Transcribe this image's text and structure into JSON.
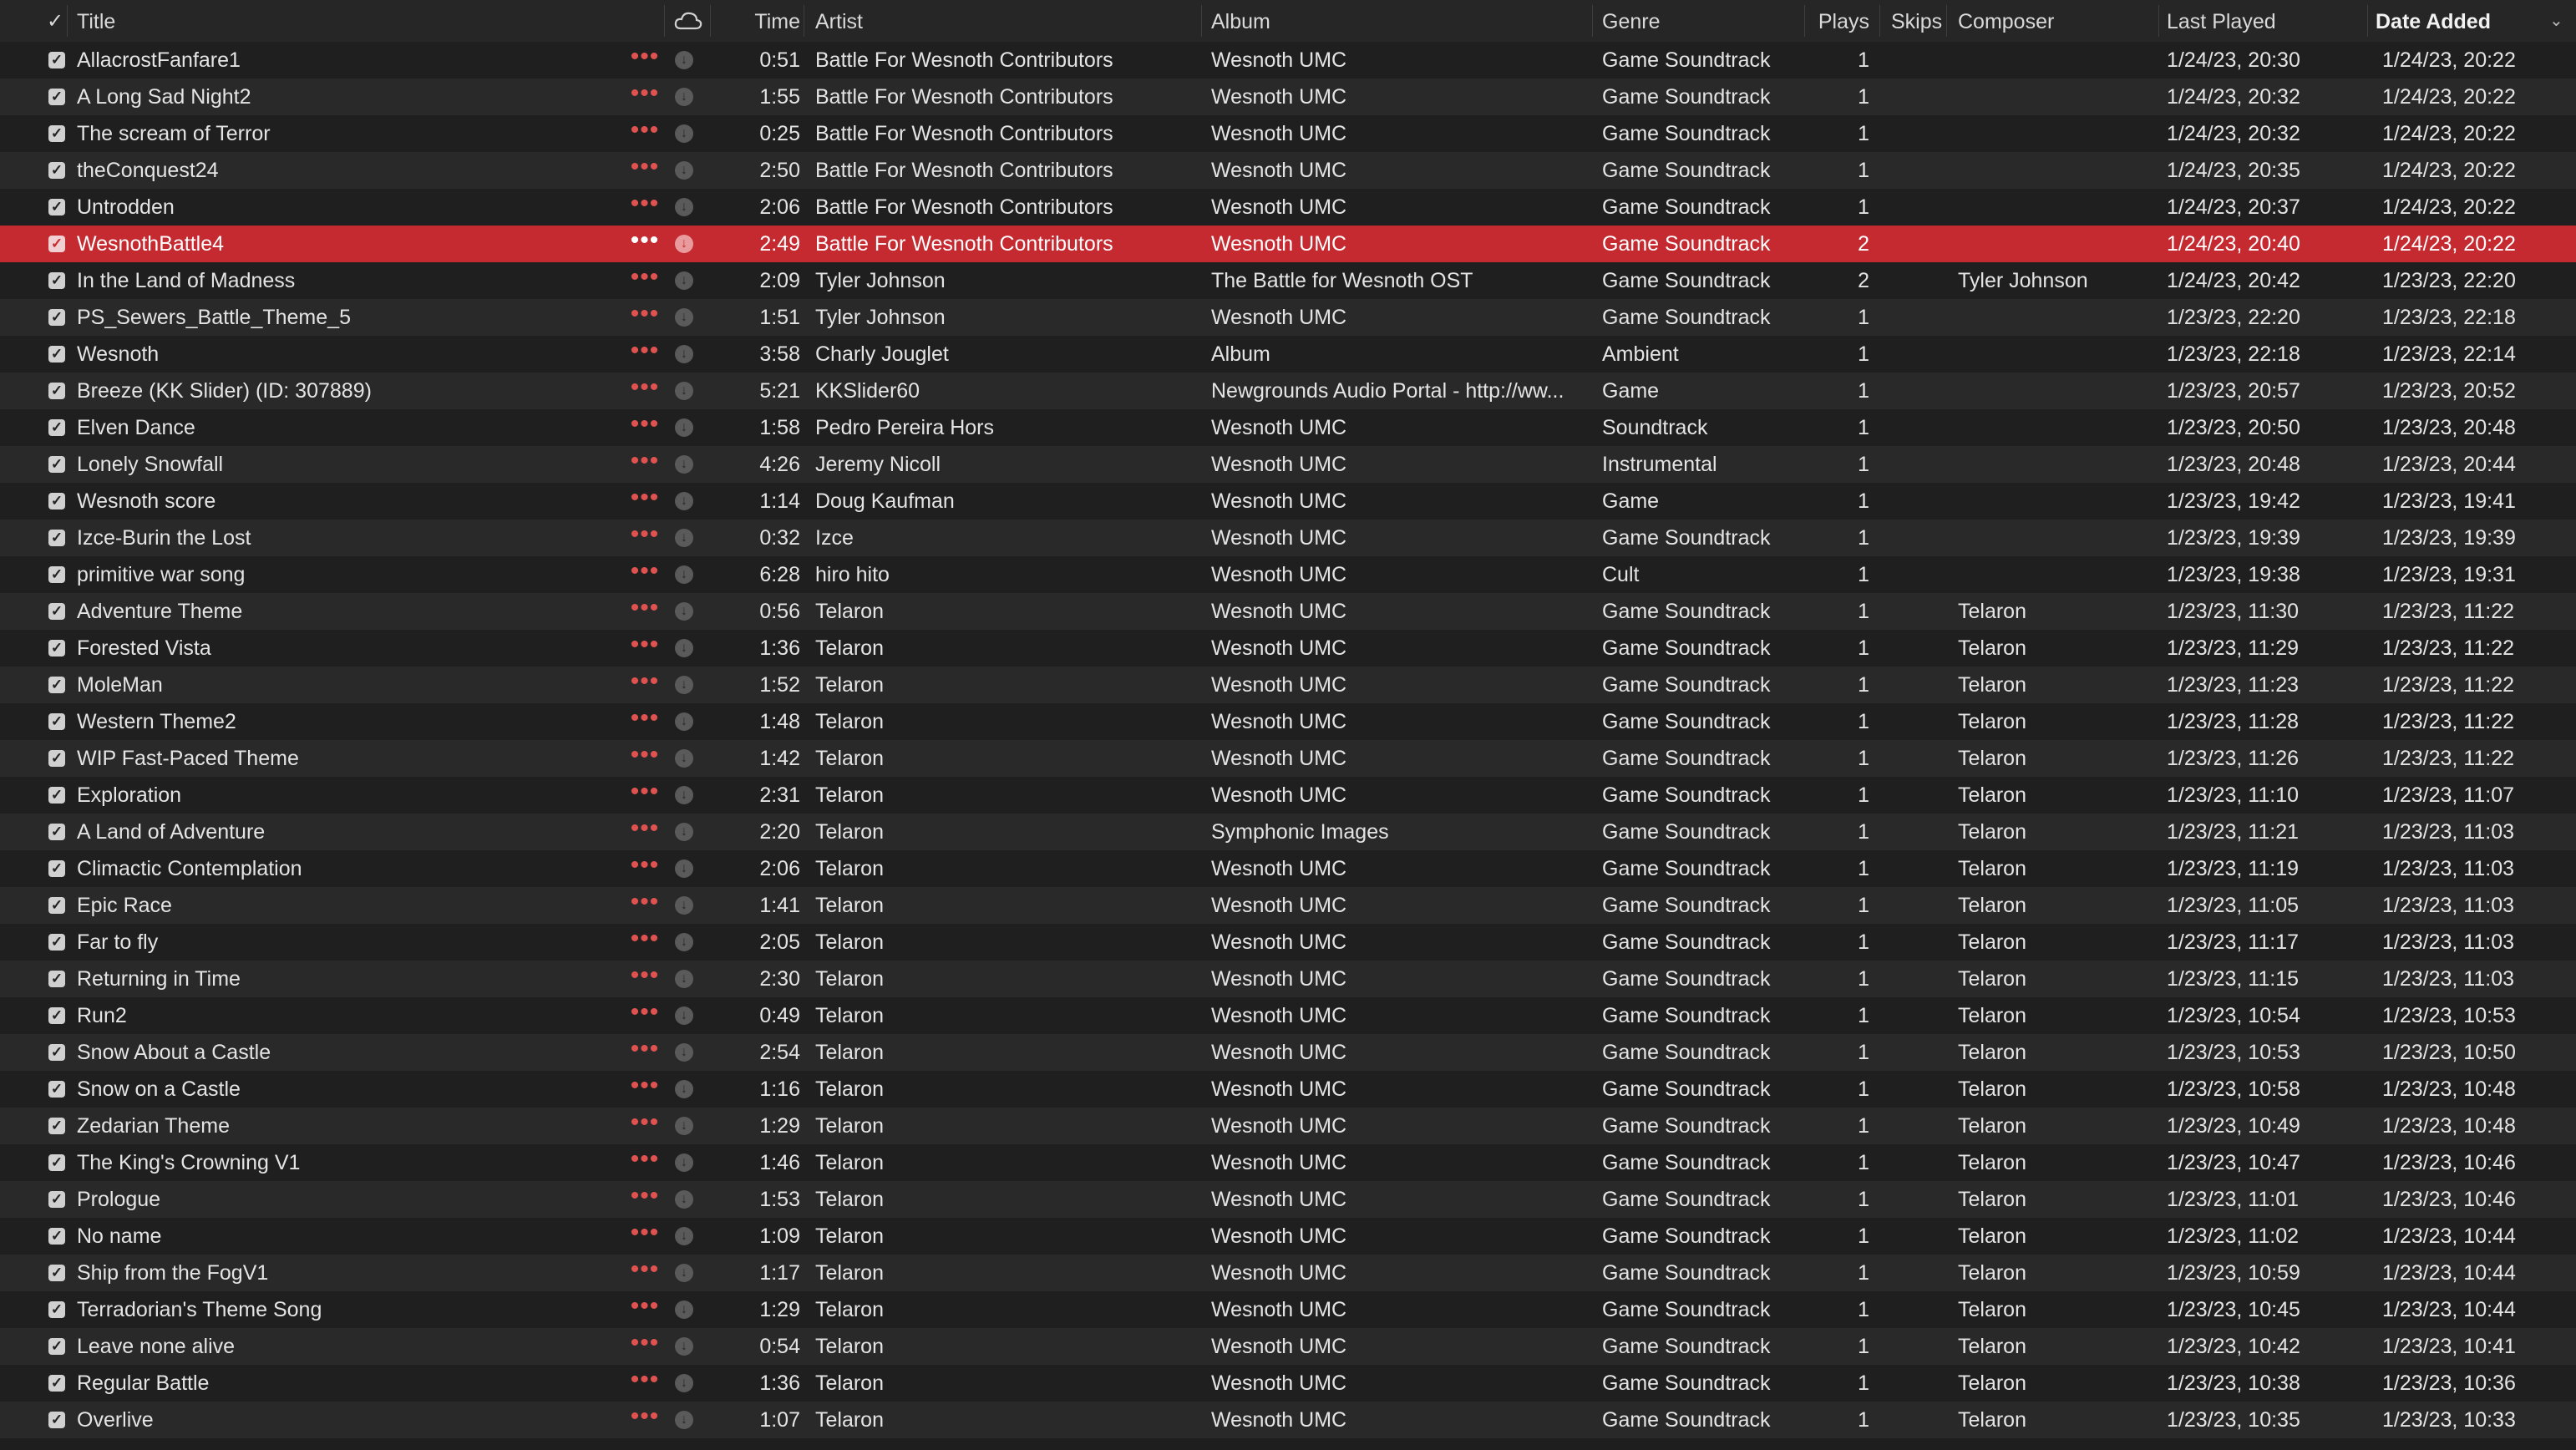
{
  "columns": {
    "check": "✓",
    "title": "Title",
    "time": "Time",
    "artist": "Artist",
    "album": "Album",
    "genre": "Genre",
    "plays": "Plays",
    "skips": "Skips",
    "composer": "Composer",
    "last_played": "Last Played",
    "date_added": "Date Added",
    "sort_indicator": "⌄"
  },
  "icons": {
    "header_cloud": "cloud-icon",
    "row_more": "more-options-icon",
    "row_download": "download-icon",
    "row_check": "checkbox-icon"
  },
  "colors": {
    "selection": "#c42a30",
    "accent_dots": "#e0524f"
  },
  "selected_index": 5,
  "tracks": [
    {
      "title": "AllacrostFanfare1",
      "time": "0:51",
      "artist": "Battle For Wesnoth Contributors",
      "album": "Wesnoth UMC",
      "genre": "Game Soundtrack",
      "plays": "1",
      "skips": "",
      "composer": "",
      "last_played": "1/24/23, 20:30",
      "date_added": "1/24/23, 20:22"
    },
    {
      "title": "A Long Sad Night2",
      "time": "1:55",
      "artist": "Battle For Wesnoth Contributors",
      "album": "Wesnoth UMC",
      "genre": "Game Soundtrack",
      "plays": "1",
      "skips": "",
      "composer": "",
      "last_played": "1/24/23, 20:32",
      "date_added": "1/24/23, 20:22"
    },
    {
      "title": "The scream of Terror",
      "time": "0:25",
      "artist": "Battle For Wesnoth Contributors",
      "album": "Wesnoth UMC",
      "genre": "Game Soundtrack",
      "plays": "1",
      "skips": "",
      "composer": "",
      "last_played": "1/24/23, 20:32",
      "date_added": "1/24/23, 20:22"
    },
    {
      "title": "theConquest24",
      "time": "2:50",
      "artist": "Battle For Wesnoth Contributors",
      "album": "Wesnoth UMC",
      "genre": "Game Soundtrack",
      "plays": "1",
      "skips": "",
      "composer": "",
      "last_played": "1/24/23, 20:35",
      "date_added": "1/24/23, 20:22"
    },
    {
      "title": "Untrodden",
      "time": "2:06",
      "artist": "Battle For Wesnoth Contributors",
      "album": "Wesnoth UMC",
      "genre": "Game Soundtrack",
      "plays": "1",
      "skips": "",
      "composer": "",
      "last_played": "1/24/23, 20:37",
      "date_added": "1/24/23, 20:22"
    },
    {
      "title": "WesnothBattle4",
      "time": "2:49",
      "artist": "Battle For Wesnoth Contributors",
      "album": "Wesnoth UMC",
      "genre": "Game Soundtrack",
      "plays": "2",
      "skips": "",
      "composer": "",
      "last_played": "1/24/23, 20:40",
      "date_added": "1/24/23, 20:22"
    },
    {
      "title": "In the Land of Madness",
      "time": "2:09",
      "artist": "Tyler Johnson",
      "album": "The Battle for Wesnoth OST",
      "genre": "Game Soundtrack",
      "plays": "2",
      "skips": "",
      "composer": "Tyler Johnson",
      "last_played": "1/24/23, 20:42",
      "date_added": "1/23/23, 22:20"
    },
    {
      "title": "PS_Sewers_Battle_Theme_5",
      "time": "1:51",
      "artist": "Tyler Johnson",
      "album": "Wesnoth UMC",
      "genre": "Game Soundtrack",
      "plays": "1",
      "skips": "",
      "composer": "",
      "last_played": "1/23/23, 22:20",
      "date_added": "1/23/23, 22:18"
    },
    {
      "title": "Wesnoth",
      "time": "3:58",
      "artist": "Charly Jouglet",
      "album": "Album",
      "genre": "Ambient",
      "plays": "1",
      "skips": "",
      "composer": "",
      "last_played": "1/23/23, 22:18",
      "date_added": "1/23/23, 22:14"
    },
    {
      "title": "Breeze (KK Slider) (ID: 307889)",
      "time": "5:21",
      "artist": "KKSlider60",
      "album": "Newgrounds Audio Portal - http://ww...",
      "genre": "Game",
      "plays": "1",
      "skips": "",
      "composer": "",
      "last_played": "1/23/23, 20:57",
      "date_added": "1/23/23, 20:52"
    },
    {
      "title": "Elven Dance",
      "time": "1:58",
      "artist": "Pedro Pereira Hors",
      "album": "Wesnoth UMC",
      "genre": "Soundtrack",
      "plays": "1",
      "skips": "",
      "composer": "",
      "last_played": "1/23/23, 20:50",
      "date_added": "1/23/23, 20:48"
    },
    {
      "title": "Lonely Snowfall",
      "time": "4:26",
      "artist": "Jeremy Nicoll",
      "album": "Wesnoth UMC",
      "genre": "Instrumental",
      "plays": "1",
      "skips": "",
      "composer": "",
      "last_played": "1/23/23, 20:48",
      "date_added": "1/23/23, 20:44"
    },
    {
      "title": "Wesnoth score",
      "time": "1:14",
      "artist": "Doug Kaufman",
      "album": "Wesnoth UMC",
      "genre": "Game",
      "plays": "1",
      "skips": "",
      "composer": "",
      "last_played": "1/23/23, 19:42",
      "date_added": "1/23/23, 19:41"
    },
    {
      "title": "Izce-Burin the Lost",
      "time": "0:32",
      "artist": "Izce",
      "album": "Wesnoth UMC",
      "genre": "Game Soundtrack",
      "plays": "1",
      "skips": "",
      "composer": "",
      "last_played": "1/23/23, 19:39",
      "date_added": "1/23/23, 19:39"
    },
    {
      "title": "primitive war song",
      "time": "6:28",
      "artist": "hiro hito",
      "album": "Wesnoth UMC",
      "genre": "Cult",
      "plays": "1",
      "skips": "",
      "composer": "",
      "last_played": "1/23/23, 19:38",
      "date_added": "1/23/23, 19:31"
    },
    {
      "title": "Adventure Theme",
      "time": "0:56",
      "artist": "Telaron",
      "album": "Wesnoth UMC",
      "genre": "Game Soundtrack",
      "plays": "1",
      "skips": "",
      "composer": "Telaron",
      "last_played": "1/23/23, 11:30",
      "date_added": "1/23/23, 11:22"
    },
    {
      "title": "Forested Vista",
      "time": "1:36",
      "artist": "Telaron",
      "album": "Wesnoth UMC",
      "genre": "Game Soundtrack",
      "plays": "1",
      "skips": "",
      "composer": "Telaron",
      "last_played": "1/23/23, 11:29",
      "date_added": "1/23/23, 11:22"
    },
    {
      "title": "MoleMan",
      "time": "1:52",
      "artist": "Telaron",
      "album": "Wesnoth UMC",
      "genre": "Game Soundtrack",
      "plays": "1",
      "skips": "",
      "composer": "Telaron",
      "last_played": "1/23/23, 11:23",
      "date_added": "1/23/23, 11:22"
    },
    {
      "title": "Western Theme2",
      "time": "1:48",
      "artist": "Telaron",
      "album": "Wesnoth UMC",
      "genre": "Game Soundtrack",
      "plays": "1",
      "skips": "",
      "composer": "Telaron",
      "last_played": "1/23/23, 11:28",
      "date_added": "1/23/23, 11:22"
    },
    {
      "title": "WIP Fast-Paced Theme",
      "time": "1:42",
      "artist": "Telaron",
      "album": "Wesnoth UMC",
      "genre": "Game Soundtrack",
      "plays": "1",
      "skips": "",
      "composer": "Telaron",
      "last_played": "1/23/23, 11:26",
      "date_added": "1/23/23, 11:22"
    },
    {
      "title": "Exploration",
      "time": "2:31",
      "artist": "Telaron",
      "album": "Wesnoth UMC",
      "genre": "Game Soundtrack",
      "plays": "1",
      "skips": "",
      "composer": "Telaron",
      "last_played": "1/23/23, 11:10",
      "date_added": "1/23/23, 11:07"
    },
    {
      "title": "A Land of Adventure",
      "time": "2:20",
      "artist": "Telaron",
      "album": "Symphonic Images",
      "genre": "Game Soundtrack",
      "plays": "1",
      "skips": "",
      "composer": "Telaron",
      "last_played": "1/23/23, 11:21",
      "date_added": "1/23/23, 11:03"
    },
    {
      "title": "Climactic Contemplation",
      "time": "2:06",
      "artist": "Telaron",
      "album": "Wesnoth UMC",
      "genre": "Game Soundtrack",
      "plays": "1",
      "skips": "",
      "composer": "Telaron",
      "last_played": "1/23/23, 11:19",
      "date_added": "1/23/23, 11:03"
    },
    {
      "title": "Epic Race",
      "time": "1:41",
      "artist": "Telaron",
      "album": "Wesnoth UMC",
      "genre": "Game Soundtrack",
      "plays": "1",
      "skips": "",
      "composer": "Telaron",
      "last_played": "1/23/23, 11:05",
      "date_added": "1/23/23, 11:03"
    },
    {
      "title": "Far to fly",
      "time": "2:05",
      "artist": "Telaron",
      "album": "Wesnoth UMC",
      "genre": "Game Soundtrack",
      "plays": "1",
      "skips": "",
      "composer": "Telaron",
      "last_played": "1/23/23, 11:17",
      "date_added": "1/23/23, 11:03"
    },
    {
      "title": "Returning in Time",
      "time": "2:30",
      "artist": "Telaron",
      "album": "Wesnoth UMC",
      "genre": "Game Soundtrack",
      "plays": "1",
      "skips": "",
      "composer": "Telaron",
      "last_played": "1/23/23, 11:15",
      "date_added": "1/23/23, 11:03"
    },
    {
      "title": "Run2",
      "time": "0:49",
      "artist": "Telaron",
      "album": "Wesnoth UMC",
      "genre": "Game Soundtrack",
      "plays": "1",
      "skips": "",
      "composer": "Telaron",
      "last_played": "1/23/23, 10:54",
      "date_added": "1/23/23, 10:53"
    },
    {
      "title": "Snow About a Castle",
      "time": "2:54",
      "artist": "Telaron",
      "album": "Wesnoth UMC",
      "genre": "Game Soundtrack",
      "plays": "1",
      "skips": "",
      "composer": "Telaron",
      "last_played": "1/23/23, 10:53",
      "date_added": "1/23/23, 10:50"
    },
    {
      "title": "Snow on a Castle",
      "time": "1:16",
      "artist": "Telaron",
      "album": "Wesnoth UMC",
      "genre": "Game Soundtrack",
      "plays": "1",
      "skips": "",
      "composer": "Telaron",
      "last_played": "1/23/23, 10:58",
      "date_added": "1/23/23, 10:48"
    },
    {
      "title": "Zedarian Theme",
      "time": "1:29",
      "artist": "Telaron",
      "album": "Wesnoth UMC",
      "genre": "Game Soundtrack",
      "plays": "1",
      "skips": "",
      "composer": "Telaron",
      "last_played": "1/23/23, 10:49",
      "date_added": "1/23/23, 10:48"
    },
    {
      "title": "The King's Crowning V1",
      "time": "1:46",
      "artist": "Telaron",
      "album": "Wesnoth UMC",
      "genre": "Game Soundtrack",
      "plays": "1",
      "skips": "",
      "composer": "Telaron",
      "last_played": "1/23/23, 10:47",
      "date_added": "1/23/23, 10:46"
    },
    {
      "title": "Prologue",
      "time": "1:53",
      "artist": "Telaron",
      "album": "Wesnoth UMC",
      "genre": "Game Soundtrack",
      "plays": "1",
      "skips": "",
      "composer": "Telaron",
      "last_played": "1/23/23, 11:01",
      "date_added": "1/23/23, 10:46"
    },
    {
      "title": "No name",
      "time": "1:09",
      "artist": "Telaron",
      "album": "Wesnoth UMC",
      "genre": "Game Soundtrack",
      "plays": "1",
      "skips": "",
      "composer": "Telaron",
      "last_played": "1/23/23, 11:02",
      "date_added": "1/23/23, 10:44"
    },
    {
      "title": "Ship from the FogV1",
      "time": "1:17",
      "artist": "Telaron",
      "album": "Wesnoth UMC",
      "genre": "Game Soundtrack",
      "plays": "1",
      "skips": "",
      "composer": "Telaron",
      "last_played": "1/23/23, 10:59",
      "date_added": "1/23/23, 10:44"
    },
    {
      "title": "Terradorian's Theme Song",
      "time": "1:29",
      "artist": "Telaron",
      "album": "Wesnoth UMC",
      "genre": "Game Soundtrack",
      "plays": "1",
      "skips": "",
      "composer": "Telaron",
      "last_played": "1/23/23, 10:45",
      "date_added": "1/23/23, 10:44"
    },
    {
      "title": "Leave none alive",
      "time": "0:54",
      "artist": "Telaron",
      "album": "Wesnoth UMC",
      "genre": "Game Soundtrack",
      "plays": "1",
      "skips": "",
      "composer": "Telaron",
      "last_played": "1/23/23, 10:42",
      "date_added": "1/23/23, 10:41"
    },
    {
      "title": "Regular Battle",
      "time": "1:36",
      "artist": "Telaron",
      "album": "Wesnoth UMC",
      "genre": "Game Soundtrack",
      "plays": "1",
      "skips": "",
      "composer": "Telaron",
      "last_played": "1/23/23, 10:38",
      "date_added": "1/23/23, 10:36"
    },
    {
      "title": "Overlive",
      "time": "1:07",
      "artist": "Telaron",
      "album": "Wesnoth UMC",
      "genre": "Game Soundtrack",
      "plays": "1",
      "skips": "",
      "composer": "Telaron",
      "last_played": "1/23/23, 10:35",
      "date_added": "1/23/23, 10:33"
    }
  ]
}
